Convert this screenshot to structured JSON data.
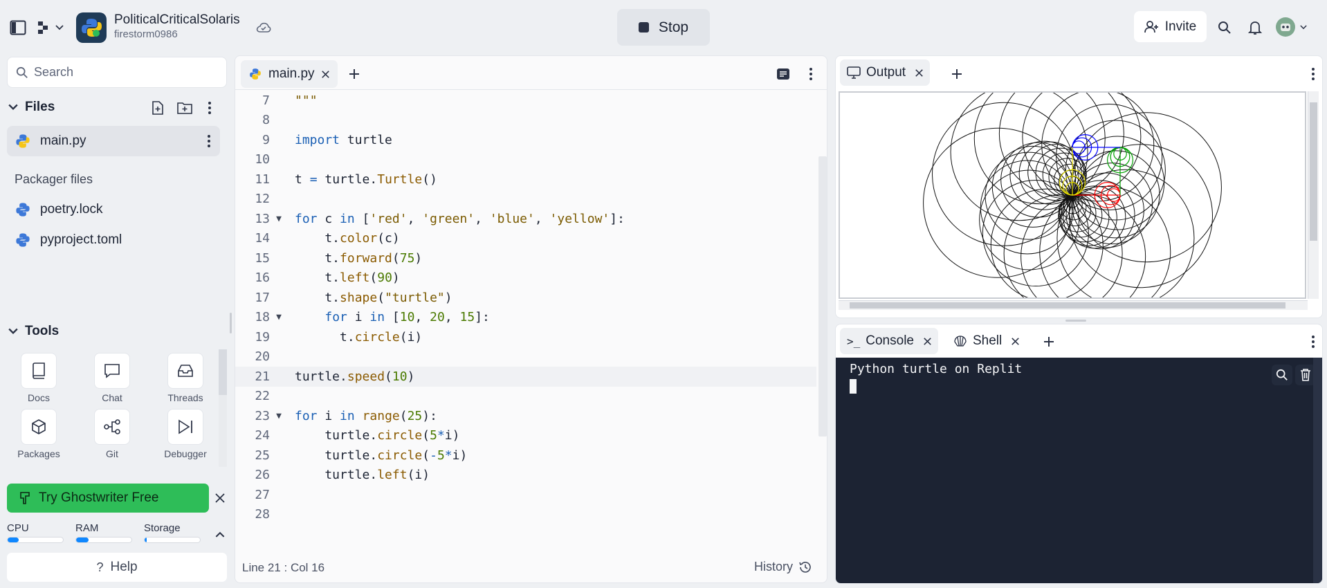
{
  "topbar": {
    "repl_title": "PoliticalCriticalSolaris",
    "owner": "firestorm0986",
    "stop_label": "Stop",
    "invite_label": "Invite"
  },
  "sidebar": {
    "search_placeholder": "Search",
    "files_heading": "Files",
    "files": [
      {
        "name": "main.py",
        "active": true
      }
    ],
    "packager_heading": "Packager files",
    "packager_files": [
      "poetry.lock",
      "pyproject.toml"
    ],
    "tools_heading": "Tools",
    "tools": [
      "Docs",
      "Chat",
      "Threads",
      "Packages",
      "Git",
      "Debugger"
    ],
    "ghostwriter_label": "Try Ghostwriter Free",
    "meters": [
      {
        "label": "CPU",
        "fraction": 0.2
      },
      {
        "label": "RAM",
        "fraction": 0.22
      },
      {
        "label": "Storage",
        "fraction": 0.04
      }
    ],
    "help_label": "Help"
  },
  "editor": {
    "tab_label": "main.py",
    "cursor_status": "Line 21 : Col 16",
    "history_label": "History",
    "lines": [
      {
        "n": "7",
        "text": "\"\"\""
      },
      {
        "n": "8",
        "text": ""
      },
      {
        "n": "9",
        "text": "import turtle"
      },
      {
        "n": "10",
        "text": ""
      },
      {
        "n": "11",
        "text": "t = turtle.Turtle()"
      },
      {
        "n": "12",
        "text": ""
      },
      {
        "n": "13",
        "text": "for c in ['red', 'green', 'blue', 'yellow']:",
        "fold": true
      },
      {
        "n": "14",
        "text": "    t.color(c)"
      },
      {
        "n": "15",
        "text": "    t.forward(75)"
      },
      {
        "n": "16",
        "text": "    t.left(90)"
      },
      {
        "n": "17",
        "text": "    t.shape(\"turtle\")"
      },
      {
        "n": "18",
        "text": "    for i in [10, 20, 15]:",
        "fold": true
      },
      {
        "n": "19",
        "text": "      t.circle(i)"
      },
      {
        "n": "20",
        "text": ""
      },
      {
        "n": "21",
        "text": "turtle.speed(10)",
        "current": true
      },
      {
        "n": "22",
        "text": ""
      },
      {
        "n": "23",
        "text": "for i in range(25):",
        "fold": true
      },
      {
        "n": "24",
        "text": "    turtle.circle(5*i)"
      },
      {
        "n": "25",
        "text": "    turtle.circle(-5*i)"
      },
      {
        "n": "26",
        "text": "    turtle.left(i)"
      },
      {
        "n": "27",
        "text": ""
      },
      {
        "n": "28",
        "text": ""
      }
    ]
  },
  "output": {
    "tab_label": "Output",
    "turtle_circle_colors": [
      "#ff0000",
      "#00a000",
      "#0000ff",
      "#e8e000"
    ]
  },
  "console": {
    "tabs": [
      "Console",
      "Shell"
    ],
    "text": "Python turtle on Replit"
  }
}
